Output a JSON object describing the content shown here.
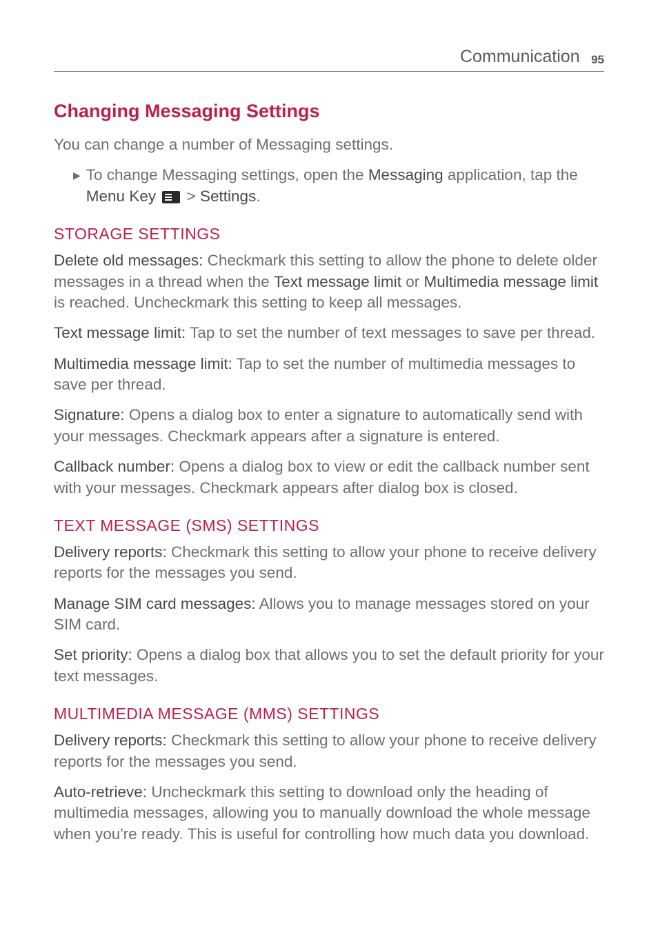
{
  "header": {
    "title": "Communication",
    "page": "95"
  },
  "sections": {
    "main_title": "Changing Messaging Settings",
    "intro": "You can change a number of Messaging settings.",
    "bullet": {
      "pre": "To change Messaging settings, open the ",
      "app": "Messaging",
      "mid": " application, tap the ",
      "menu_key": "Menu Key",
      "gt": " > ",
      "settings": "Settings",
      "end": "."
    },
    "storage": {
      "title": "STORAGE SETTINGS",
      "items": {
        "delete": {
          "label": "Delete old messages:",
          "pre": " Checkmark this setting to allow the phone to delete older messages in a thread when the ",
          "b1": "Text message limit",
          "mid": " or ",
          "b2": "Multimedia message limit",
          "post": " is reached. Uncheckmark this setting to keep all messages."
        },
        "text_limit": {
          "label": "Text message limit:",
          "text": " Tap to set the number of text messages to save per thread."
        },
        "mm_limit": {
          "label": "Multimedia message limit:",
          "text": " Tap to set the number of multimedia messages to save per thread."
        },
        "signature": {
          "label": "Signature:",
          "text": " Opens a dialog box to enter a signature to automatically send with your messages. Checkmark appears after a signature is entered."
        },
        "callback": {
          "label": "Callback number:",
          "text": " Opens a dialog box to view or edit the callback number sent with your messages. Checkmark appears after dialog box is closed."
        }
      }
    },
    "sms": {
      "title": "TEXT MESSAGE (SMS) SETTINGS",
      "items": {
        "delivery": {
          "label": "Delivery reports:",
          "text": " Checkmark this setting to allow your phone to receive delivery reports for the messages you send."
        },
        "sim": {
          "label": "Manage SIM card messages:",
          "text": " Allows you to manage messages stored on your SIM card."
        },
        "priority": {
          "label": "Set priority:",
          "text": " Opens a dialog box that allows you to set the default priority for your text messages."
        }
      }
    },
    "mms": {
      "title": "MULTIMEDIA MESSAGE (MMS) SETTINGS",
      "items": {
        "delivery": {
          "label": "Delivery reports:",
          "text": " Checkmark this setting to allow your phone to receive delivery reports for the messages you send."
        },
        "auto": {
          "label": "Auto-retrieve:",
          "text": " Uncheckmark this setting to download only the heading of multimedia messages, allowing you to manually download the whole message when you're ready. This is useful for controlling how much data you download."
        }
      }
    }
  }
}
